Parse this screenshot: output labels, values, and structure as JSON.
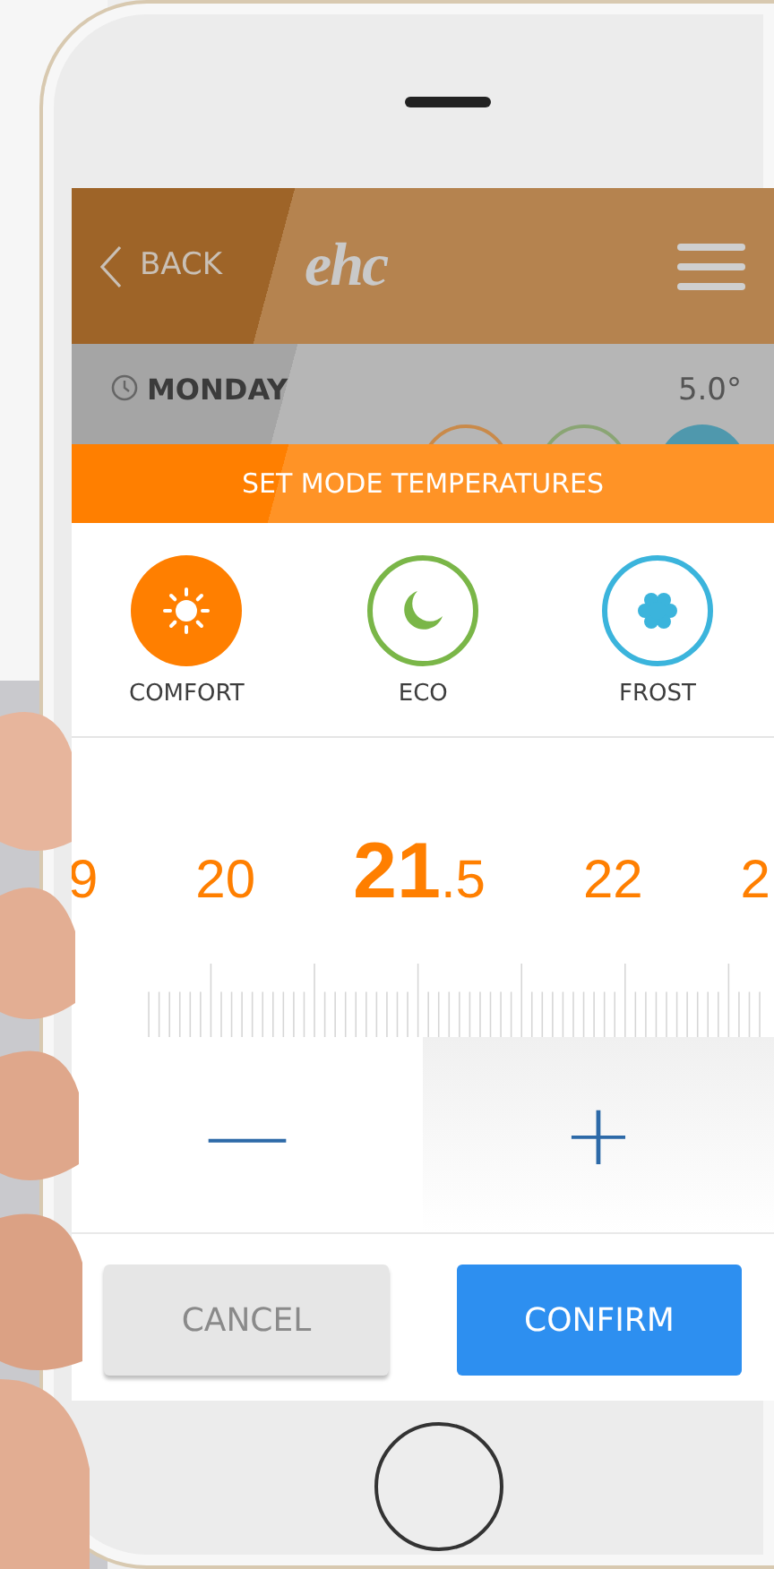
{
  "header": {
    "back": "BACK",
    "logo": "ehc"
  },
  "day_row": {
    "day": "MONDAY",
    "temperature": "5.0°"
  },
  "mode_bar": {
    "title": "SET MODE TEMPERATURES"
  },
  "modes": [
    {
      "kind": "sun",
      "label": "COMFORT",
      "color": "#ff7f00",
      "selected": true
    },
    {
      "kind": "moon",
      "label": "ECO",
      "color": "#7ab648",
      "selected": false
    },
    {
      "kind": "snow",
      "label": "FROST",
      "color": "#3bb4dc",
      "selected": false
    }
  ],
  "ruler": {
    "labels": [
      "9",
      "20",
      "22",
      "2"
    ],
    "value_whole": "21",
    "value_fraction": ".5"
  },
  "stepper": {
    "minus": "—",
    "plus": "+"
  },
  "buttons": [
    {
      "kind": "cancel",
      "label": "CANCEL"
    },
    {
      "kind": "confirm",
      "label": "CONFIRM"
    }
  ]
}
